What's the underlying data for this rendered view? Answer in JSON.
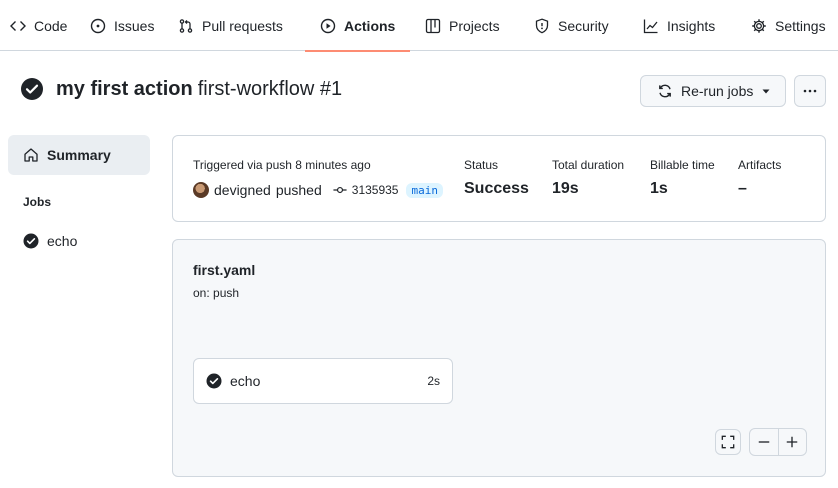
{
  "nav": {
    "tabs": [
      {
        "label": "Code",
        "icon": "code-icon"
      },
      {
        "label": "Issues",
        "icon": "issue-opened-icon"
      },
      {
        "label": "Pull requests",
        "icon": "git-pull-request-icon"
      },
      {
        "label": "Actions",
        "icon": "play-icon",
        "selected": true
      },
      {
        "label": "Projects",
        "icon": "table-icon"
      },
      {
        "label": "Security",
        "icon": "shield-icon"
      },
      {
        "label": "Insights",
        "icon": "graph-icon"
      },
      {
        "label": "Settings",
        "icon": "gear-icon"
      }
    ]
  },
  "run": {
    "title": "my first action",
    "subtitle": "first-workflow #1",
    "rerun_label": "Re-run jobs"
  },
  "sidebar": {
    "summary_label": "Summary",
    "jobs_heading": "Jobs",
    "jobs": [
      {
        "label": "echo"
      }
    ]
  },
  "summary": {
    "trigger": "Triggered via push 8 minutes ago",
    "actor": "devigned",
    "action": "pushed",
    "commit_sha": "3135935",
    "branch": "main",
    "stats": [
      {
        "label": "Status",
        "value": "Success"
      },
      {
        "label": "Total duration",
        "value": "19s"
      },
      {
        "label": "Billable time",
        "value": "1s"
      },
      {
        "label": "Artifacts",
        "value": "–"
      }
    ]
  },
  "workflow": {
    "file": "first.yaml",
    "on": "on: push",
    "job": {
      "label": "echo",
      "duration": "2s"
    }
  },
  "colors": {
    "accent_underline": "#fd8c73",
    "success_icon": "#1f2328",
    "branch_text": "#0969da",
    "branch_bg": "#ddf4ff",
    "border": "#d0d7de"
  }
}
